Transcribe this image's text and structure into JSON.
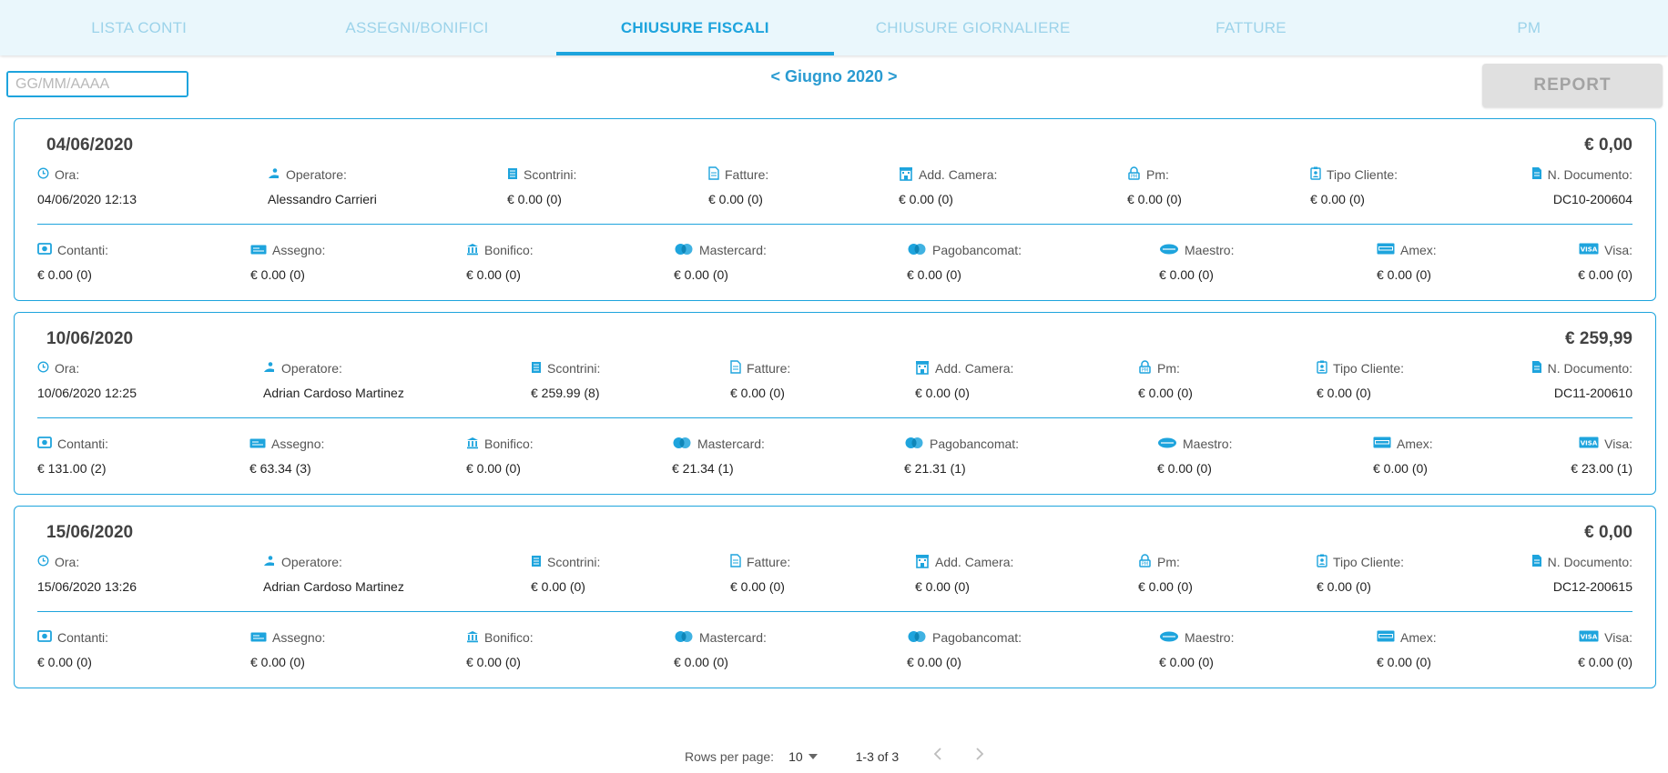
{
  "tabs": [
    "LISTA CONTI",
    "ASSEGNI/BONIFICI",
    "CHIUSURE FISCALI",
    "CHIUSURE GIORNALIERE",
    "FATTURE",
    "PM"
  ],
  "toolbar": {
    "date_placeholder": "GG/MM/AAAA",
    "month_prev": "<",
    "month_label": "Giugno 2020",
    "month_next": ">",
    "report_label": "REPORT"
  },
  "labels": {
    "ora": "Ora:",
    "operatore": "Operatore:",
    "scontrini": "Scontrini:",
    "fatture": "Fatture:",
    "add_camera": "Add. Camera:",
    "pm": "Pm:",
    "tipo_cliente": "Tipo Cliente:",
    "n_documento": "N. Documento:",
    "contanti": "Contanti:",
    "assegno": "Assegno:",
    "bonifico": "Bonifico:",
    "mastercard": "Mastercard:",
    "pagobancomat": "Pagobancomat:",
    "maestro": "Maestro:",
    "amex": "Amex:",
    "visa": "Visa:"
  },
  "closures": [
    {
      "date": "04/06/2020",
      "total": "€ 0,00",
      "ora": "04/06/2020 12:13",
      "operatore": "Alessandro Carrieri",
      "scontrini": "€ 0.00 (0)",
      "fatture": "€ 0.00 (0)",
      "add_camera": "€ 0.00 (0)",
      "pm": "€ 0.00 (0)",
      "tipo_cliente": "€ 0.00 (0)",
      "n_documento": "DC10-200604",
      "contanti": "€ 0.00 (0)",
      "assegno": "€ 0.00 (0)",
      "bonifico": "€ 0.00 (0)",
      "mastercard": "€ 0.00 (0)",
      "pagobancomat": "€ 0.00 (0)",
      "maestro": "€ 0.00 (0)",
      "amex": "€ 0.00 (0)",
      "visa": "€ 0.00 (0)"
    },
    {
      "date": "10/06/2020",
      "total": "€ 259,99",
      "ora": "10/06/2020 12:25",
      "operatore": "Adrian Cardoso Martinez",
      "scontrini": "€ 259.99 (8)",
      "fatture": "€ 0.00 (0)",
      "add_camera": "€ 0.00 (0)",
      "pm": "€ 0.00 (0)",
      "tipo_cliente": "€ 0.00 (0)",
      "n_documento": "DC11-200610",
      "contanti": "€ 131.00 (2)",
      "assegno": "€ 63.34 (3)",
      "bonifico": "€ 0.00 (0)",
      "mastercard": "€ 21.34 (1)",
      "pagobancomat": "€ 21.31 (1)",
      "maestro": "€ 0.00 (0)",
      "amex": "€ 0.00 (0)",
      "visa": "€ 23.00 (1)"
    },
    {
      "date": "15/06/2020",
      "total": "€ 0,00",
      "ora": "15/06/2020 13:26",
      "operatore": "Adrian Cardoso Martinez",
      "scontrini": "€ 0.00 (0)",
      "fatture": "€ 0.00 (0)",
      "add_camera": "€ 0.00 (0)",
      "pm": "€ 0.00 (0)",
      "tipo_cliente": "€ 0.00 (0)",
      "n_documento": "DC12-200615",
      "contanti": "€ 0.00 (0)",
      "assegno": "€ 0.00 (0)",
      "bonifico": "€ 0.00 (0)",
      "mastercard": "€ 0.00 (0)",
      "pagobancomat": "€ 0.00 (0)",
      "maestro": "€ 0.00 (0)",
      "amex": "€ 0.00 (0)",
      "visa": "€ 0.00 (0)"
    }
  ],
  "icons": {
    "ora": "clock-icon",
    "operatore": "user-icon",
    "scontrini": "receipt-icon",
    "fatture": "invoice-icon",
    "add_camera": "hotel-icon",
    "pm": "lock-icon",
    "tipo_cliente": "id-badge-icon",
    "n_documento": "document-icon",
    "contanti": "cash-icon",
    "assegno": "check-icon",
    "bonifico": "bank-icon",
    "mastercard": "mastercard-icon",
    "pagobancomat": "pagobancomat-icon",
    "maestro": "maestro-icon",
    "amex": "amex-icon",
    "visa": "visa-icon"
  },
  "pagination": {
    "rows_per_page_label": "Rows per page:",
    "rows_per_page_value": "10",
    "range": "1-3 of 3"
  },
  "colors": {
    "accent": "#1ea4dd",
    "tab_inactive": "#9cd3ea",
    "tab_bar_bg": "#eaf7fc",
    "report_disabled_bg": "#e0e0e0"
  }
}
